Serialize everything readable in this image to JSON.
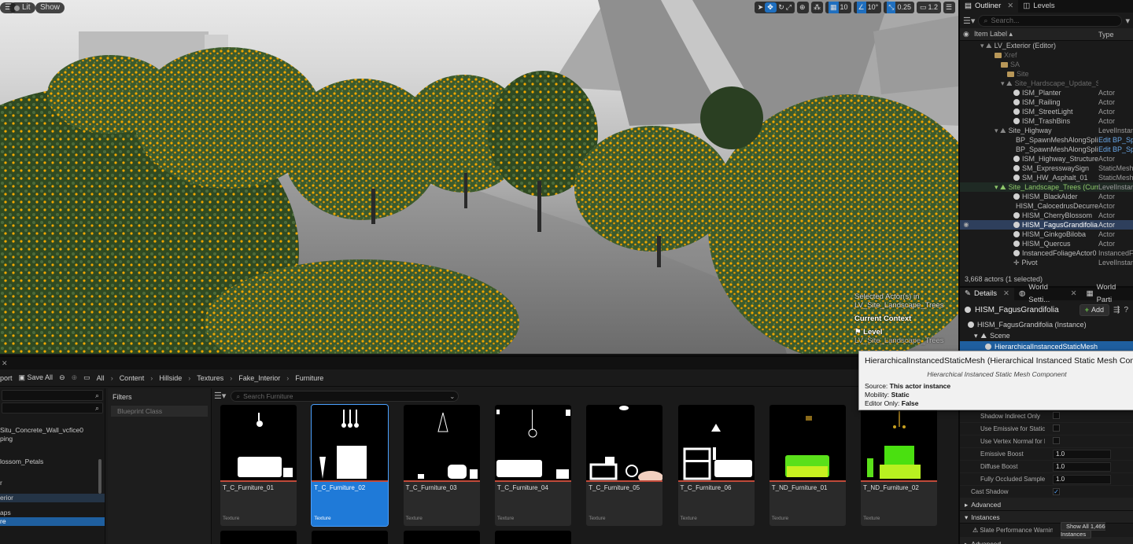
{
  "viewport": {
    "lit_label": "Lit",
    "show_label": "Show",
    "grid_value": "10",
    "angle_value": "10°",
    "scale_value": "0.25",
    "camera_value": "1.2",
    "selected_title": "Selected Actor(s) in",
    "selected_level": "LV_Site_Landscape_Trees",
    "current_context": "Current Context",
    "level_label": "Level",
    "level_name": "LV_Site_Landscape_Trees"
  },
  "outliner": {
    "tab": "Outliner",
    "tab2": "Levels",
    "search_placeholder": "Search...",
    "col_label": "Item Label",
    "col_type": "Type",
    "rows": [
      {
        "name": "LV_Exterior (Editor)",
        "type": ""
      },
      {
        "name": "Xref",
        "type": ""
      },
      {
        "name": "SA",
        "type": ""
      },
      {
        "name": "Site",
        "type": ""
      },
      {
        "name": "Site_Hardscape_Update_SD",
        "type": ""
      },
      {
        "name": "ISM_Planter",
        "type": "Actor"
      },
      {
        "name": "ISM_Railing",
        "type": "Actor"
      },
      {
        "name": "ISM_StreetLight",
        "type": "Actor"
      },
      {
        "name": "ISM_TrashBins",
        "type": "Actor"
      },
      {
        "name": "Site_Highway",
        "type": "LevelInstance"
      },
      {
        "name": "BP_SpawnMeshAlongSplin",
        "type": "Edit BP_Spa"
      },
      {
        "name": "BP_SpawnMeshAlongSplin",
        "type": "Edit BP_Spa"
      },
      {
        "name": "ISM_Highway_Structure",
        "type": "Actor"
      },
      {
        "name": "SM_ExpresswaySign",
        "type": "StaticMesh"
      },
      {
        "name": "SM_HW_Asphalt_01",
        "type": "StaticMesh"
      },
      {
        "name": "Site_Landscape_Trees (Curre",
        "type": "LevelInstance"
      },
      {
        "name": "HISM_BlackAlder",
        "type": "Actor"
      },
      {
        "name": "HISM_CalocedrusDecurren",
        "type": "Actor"
      },
      {
        "name": "HISM_CherryBlossom",
        "type": "Actor"
      },
      {
        "name": "HISM_FagusGrandifolia",
        "type": "Actor"
      },
      {
        "name": "HISM_GinkgoBiloba",
        "type": "Actor"
      },
      {
        "name": "HISM_Quercus",
        "type": "Actor"
      },
      {
        "name": "InstancedFoliageActor0",
        "type": "InstancedFo"
      },
      {
        "name": "Pivot",
        "type": "LevelInstance"
      }
    ],
    "footer": "3,668 actors (1 selected)"
  },
  "details": {
    "tab": "Details",
    "tab2": "World Setti...",
    "tab3": "World Parti",
    "actor_name": "HISM_FagusGrandifolia",
    "add_label": "Add",
    "instance_row": "HISM_FagusGrandifolia (Instance)",
    "scene_row": "Scene",
    "component_row": "HierarchicalInstancedStaticMesh",
    "props": [
      {
        "name": "Shadow Indirect Only",
        "kind": "check",
        "value": ""
      },
      {
        "name": "Use Emissive for Static Lig...",
        "kind": "check",
        "value": ""
      },
      {
        "name": "Use Vertex Normal for Hem...",
        "kind": "check",
        "value": ""
      },
      {
        "name": "Emissive Boost",
        "kind": "num",
        "value": "1.0"
      },
      {
        "name": "Diffuse Boost",
        "kind": "num",
        "value": "1.0"
      },
      {
        "name": "Fully Occluded Samples Fr...",
        "kind": "num",
        "value": "1.0"
      }
    ],
    "cast_shadow": "Cast Shadow",
    "advanced": "Advanced",
    "instances": "Instances",
    "slate_warning": "Slate Performance Warning",
    "show_all": "Show All 1,466 Instances",
    "advanced2": "Advanced"
  },
  "tooltip": {
    "title": "HierarchicalInstancedStaticMesh (Hierarchical Instanced Static Mesh Component)",
    "subtitle": "Hierarchical Instanced Static Mesh Component",
    "source_k": "Source:",
    "source_v": "This actor instance",
    "mobility_k": "Mobility:",
    "mobility_v": "Static",
    "editor_k": "Editor Only:",
    "editor_v": "False"
  },
  "content_browser": {
    "import_label": "port",
    "save_all": "Save All",
    "crumbs": [
      "All",
      "Content",
      "Hillside",
      "Textures",
      "Fake_Interior",
      "Furniture"
    ],
    "tree": [
      "Situ_Concrete_Wall_vcfice0",
      "ping",
      "lossom_Petals",
      "r",
      "erior",
      "aps",
      "re"
    ],
    "filters_title": "Filters",
    "filter_chip": "Blueprint Class",
    "search_placeholder": "Search Furniture",
    "assets": [
      {
        "name": "T_C_Furniture_01",
        "type": "Texture"
      },
      {
        "name": "T_C_Furniture_02",
        "type": "Texture"
      },
      {
        "name": "T_C_Furniture_03",
        "type": "Texture"
      },
      {
        "name": "T_C_Furniture_04",
        "type": "Texture"
      },
      {
        "name": "T_C_Furniture_05",
        "type": "Texture"
      },
      {
        "name": "T_C_Furniture_06",
        "type": "Texture"
      },
      {
        "name": "T_ND_Furniture_01",
        "type": "Texture"
      },
      {
        "name": "T_ND_Furniture_02",
        "type": "Texture"
      }
    ]
  },
  "colors": {
    "accent": "#1f7ad8",
    "selection_outline": "#f0a000",
    "foliage_green": "#3d5a2a"
  }
}
